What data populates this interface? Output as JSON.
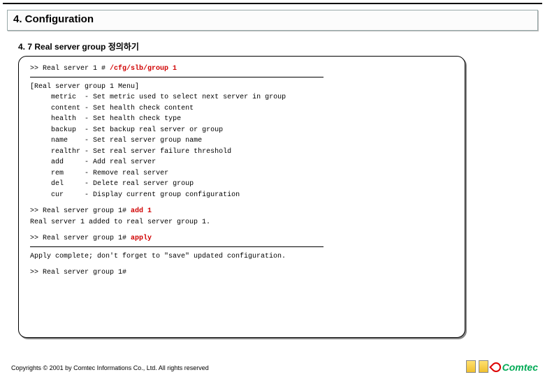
{
  "header": {
    "title": "4. Configuration"
  },
  "subtitle": "4. 7 Real server group 정의하기",
  "term": {
    "prompt1_pre": ">> Real server 1 # ",
    "prompt1_cmd": "/cfg/slb/group 1",
    "menu_header": "[Real server group 1 Menu]",
    "menu": [
      {
        "k": "metric",
        "d": "- Set metric used to select next server in group"
      },
      {
        "k": "content",
        "d": "- Set health check content"
      },
      {
        "k": "health",
        "d": "- Set health check type"
      },
      {
        "k": "backup",
        "d": "- Set backup real server or group"
      },
      {
        "k": "name",
        "d": "- Set real server group name"
      },
      {
        "k": "realthr",
        "d": "- Set real server failure threshold"
      },
      {
        "k": "add",
        "d": "- Add real server"
      },
      {
        "k": "rem",
        "d": "- Remove real server"
      },
      {
        "k": "del",
        "d": "- Delete real server group"
      },
      {
        "k": "cur",
        "d": "- Display current group configuration"
      }
    ],
    "prompt2_pre": ">> Real server group 1# ",
    "prompt2_cmd": "add 1",
    "added_msg": "Real server 1 added to real server group 1.",
    "prompt3_pre": ">> Real server group 1# ",
    "prompt3_cmd": "apply",
    "apply_msg": "Apply complete; don't forget to \"save\" updated configuration.",
    "prompt4": ">> Real server group 1#"
  },
  "footer": "Copyrights © 2001 by Comtec Informations Co., Ltd. All rights reserved",
  "logo_text": "Comtec"
}
